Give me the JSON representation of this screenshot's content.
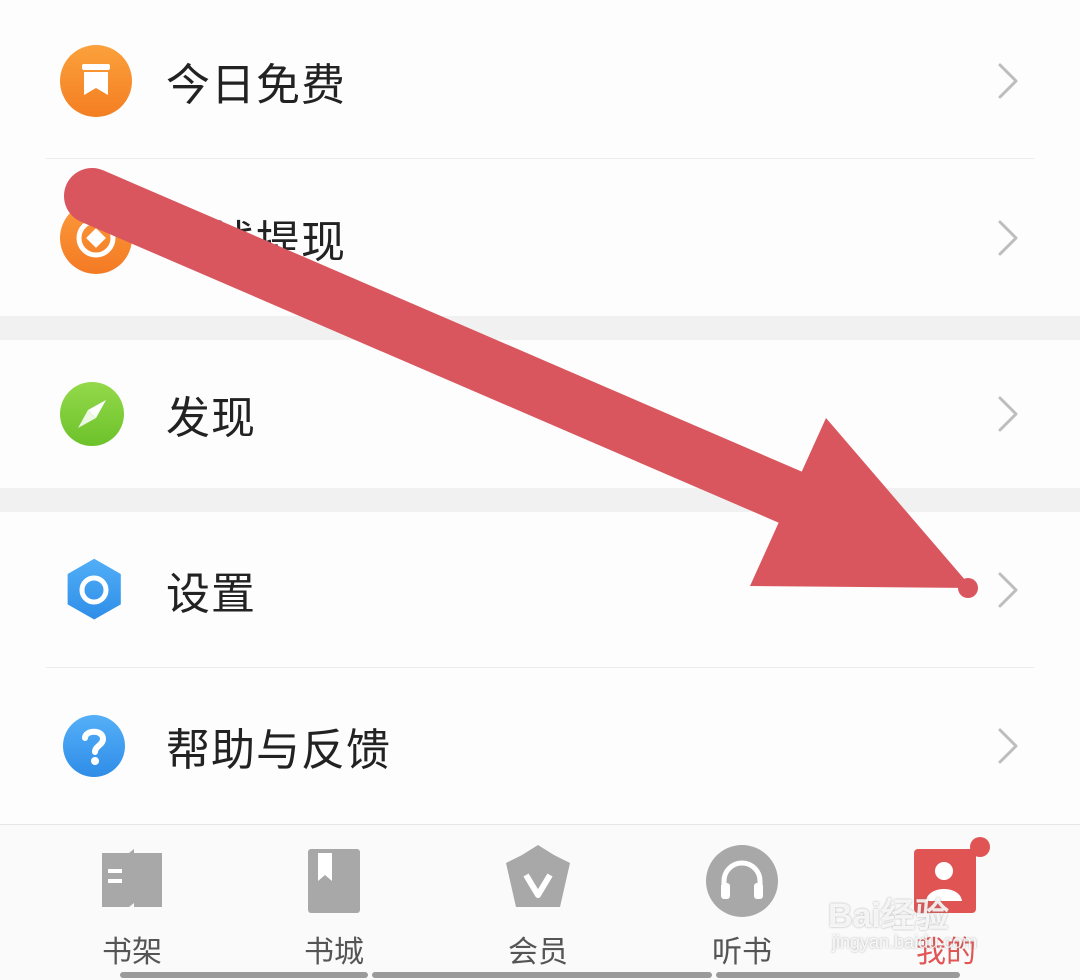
{
  "menu": {
    "items": [
      {
        "id": "today-free",
        "label": "今日免费",
        "icon": "bookmark-icon",
        "color": "#f7922f"
      },
      {
        "id": "withdraw",
        "label": "零钱提现",
        "icon": "coin-icon",
        "color": "#f7872f"
      },
      {
        "id": "discover",
        "label": "发现",
        "icon": "compass-icon",
        "color": "#7dcc35"
      },
      {
        "id": "settings",
        "label": "设置",
        "icon": "settings-hexagon-icon",
        "color": "#3d9cf0"
      },
      {
        "id": "help",
        "label": "帮助与反馈",
        "icon": "question-icon",
        "color": "#3d9cf0"
      }
    ]
  },
  "tabbar": {
    "tabs": [
      {
        "id": "bookshelf",
        "label": "书架",
        "icon": "book-open-icon",
        "active": false
      },
      {
        "id": "bookstore",
        "label": "书城",
        "icon": "book-bookmark-icon",
        "active": false
      },
      {
        "id": "vip",
        "label": "会员",
        "icon": "crown-icon",
        "active": false
      },
      {
        "id": "audiobook",
        "label": "听书",
        "icon": "headphones-icon",
        "active": false
      },
      {
        "id": "mine",
        "label": "我的",
        "icon": "profile-icon",
        "active": true
      }
    ]
  },
  "annotation": {
    "color": "#d9565e"
  },
  "watermark": {
    "main": "Bai经验",
    "sub": "jingyan.baidu.com"
  }
}
